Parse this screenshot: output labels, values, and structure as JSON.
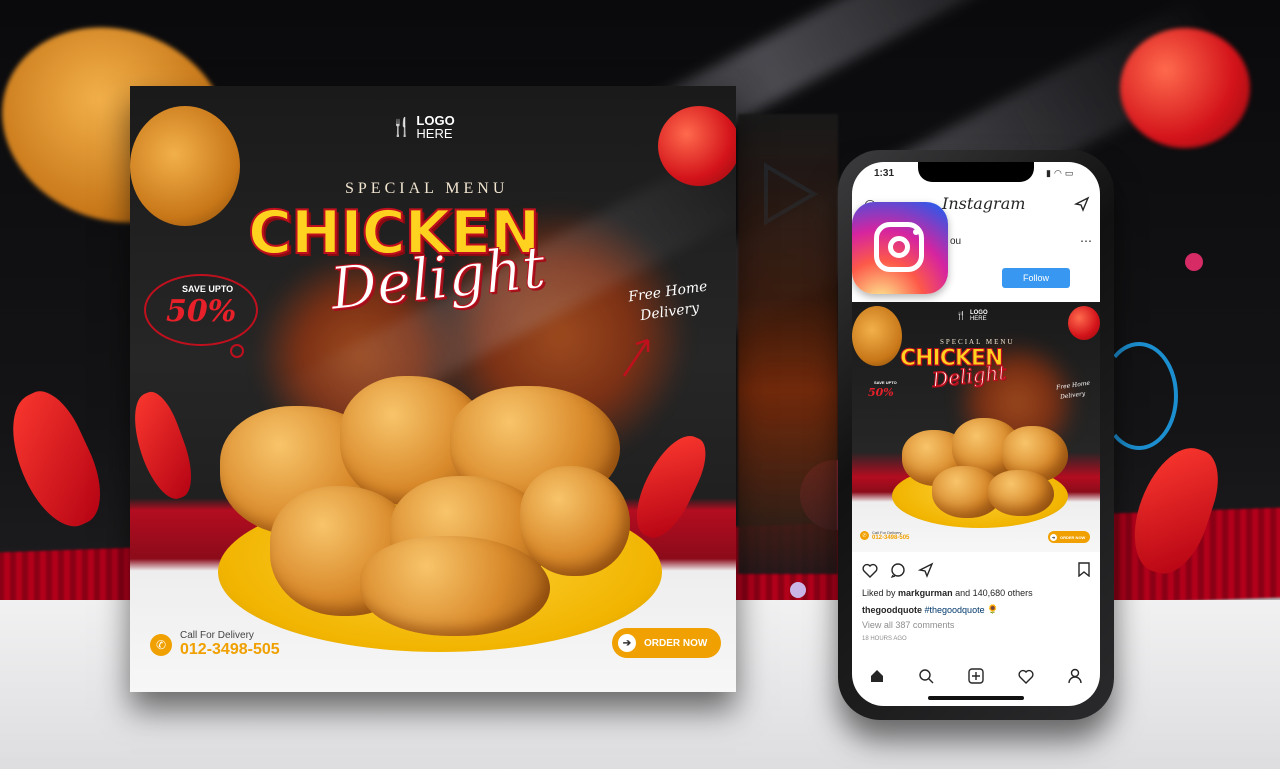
{
  "poster": {
    "logo_line1": "LOGO",
    "logo_line2": "HERE",
    "special_menu": "SPECIAL MENU",
    "title_main": "CHICKEN",
    "title_script": "Delight",
    "save_label": "SAVE UPTO",
    "save_value": "50%",
    "free_line1": "Free Home",
    "free_line2": "Delivery",
    "call_label": "Call For Delivery",
    "call_number": "012-3498-505",
    "order_label": "ORDER NOW"
  },
  "phone": {
    "status_time": "1:31",
    "app_title": "Instagram",
    "username_fragment": "ou",
    "follow_label": "Follow",
    "liked_by_prefix": "Liked by ",
    "liked_by_user": "markgurman",
    "liked_by_suffix": " and 140,680 others",
    "caption_user": "thegoodquote",
    "caption_tag": "#thegoodquote",
    "view_comments": "View all 387 comments",
    "time_ago": "18 HOURS AGO",
    "mini_post": {
      "logo_line1": "LOGO",
      "logo_line2": "HERE",
      "special_menu": "SPECIAL MENU",
      "title_main": "CHICKEN",
      "title_script": "Delight",
      "save_label": "SAVE UPTO",
      "save_value": "50%",
      "free_line1": "Free Home",
      "free_line2": "Delivery",
      "call_label": "Call For Delivery",
      "call_number": "012-3498-505",
      "order_label": "ORDER NOW"
    }
  },
  "icons": [
    "fork-knife-icon",
    "phone-icon",
    "arrow-right-icon",
    "instagram-icon",
    "send-icon",
    "heart-icon",
    "comment-icon",
    "share-icon",
    "bookmark-icon",
    "home-icon",
    "search-icon",
    "add-icon",
    "profile-icon",
    "more-icon",
    "camera-icon"
  ],
  "colors": {
    "accent_yellow": "#ffd21f",
    "accent_red": "#c0101e",
    "order_orange": "#f0a000",
    "follow_blue": "#3897f0"
  }
}
